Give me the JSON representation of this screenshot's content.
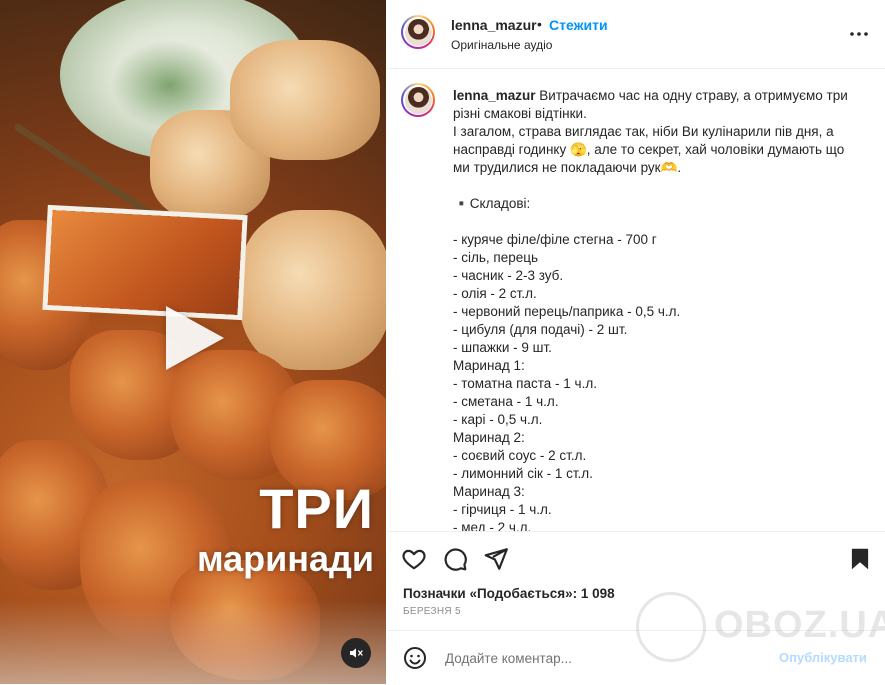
{
  "media": {
    "overlay_title": "ТРИ",
    "overlay_subtitle": "маринади",
    "play_icon": "play-icon",
    "mute_icon": "speaker-muted-icon"
  },
  "header": {
    "username": "lenna_mazur",
    "separator": "•",
    "follow_label": "Стежити",
    "audio_label": "Оригінальне аудіо",
    "more_icon": "more-horizontal-icon"
  },
  "caption": {
    "username": "lenna_mazur",
    "intro": " Витрачаємо час на одну страву, а отримуємо три різні смакові відтінки.",
    "line2": "І загалом, страва виглядає так, ніби Ви кулінарили пів дня, а насправді годинку 🫣, але то секрет, хай чоловіки думають що ми трудилися не покладаючи рук🫶.",
    "ingredients_title": "▪️Складові:",
    "ingredients": [
      "- куряче філе/філе стегна - 700 г",
      "- сіль, перець",
      "- часник - 2-3 зуб.",
      "- олія - 2 ст.л.",
      "- червоний перець/паприка - 0,5 ч.л.",
      "- цибуля (для подачі) - 2 шт.",
      "- шпажки - 9 шт.",
      "Маринад 1:",
      "- томатна паста - 1 ч.л.",
      "- сметана - 1 ч.л.",
      "- карі - 0,5 ч.л.",
      "Маринад 2:",
      "- соєвий соус - 2 ст.л.",
      "- лимонний сік - 1 ст.л.",
      "Маринад 3:",
      "- гірчиця - 1 ч.л.",
      "- мед - 2 ч.л."
    ]
  },
  "actions": {
    "like_icon": "heart-icon",
    "comment_icon": "comment-icon",
    "share_icon": "share-icon",
    "save_icon": "bookmark-icon"
  },
  "likes_text": "Позначки «Подобається»: 1 098",
  "date_text": "БЕРЕЗНЯ 5",
  "comment": {
    "emoji_icon": "emoji-icon",
    "placeholder": "Додайте коментар...",
    "publish_label": "Опублікувати"
  },
  "watermark": "OBOZ.UA",
  "colors": {
    "accent": "#0095f6",
    "publish_disabled": "#b3dbff",
    "text": "#262626",
    "secondary": "#737373"
  }
}
